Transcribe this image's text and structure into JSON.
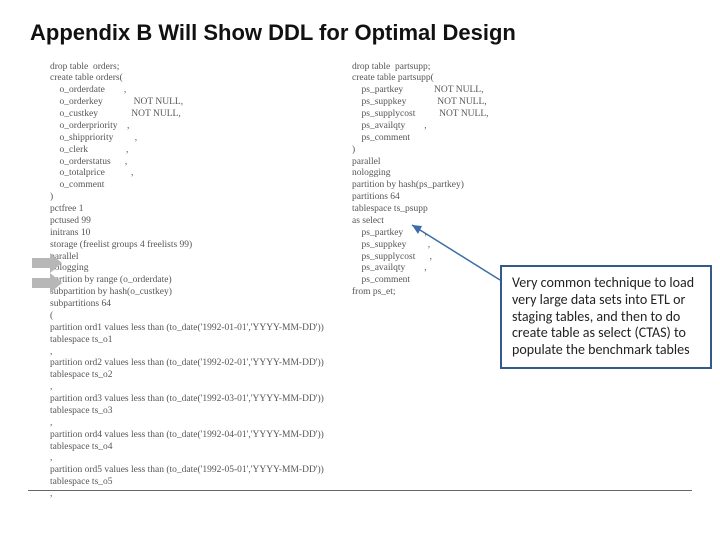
{
  "title": "Appendix B Will Show DDL for Optimal Design",
  "ddl_left": "drop table  orders;\ncreate table orders(\n    o_orderdate        ,\n    o_orderkey             NOT NULL,\n    o_custkey              NOT NULL,\n    o_orderpriority    ,\n    o_shippriority         ,\n    o_clerk                ,\n    o_orderstatus      ,\n    o_totalprice           ,\n    o_comment\n)\npctfree 1\npctused 99\ninitrans 10\nstorage (freelist groups 4 freelists 99)\nparallel\nnologging\npartition by range (o_orderdate)\nsubpartition by hash(o_custkey)\nsubpartitions 64\n(\npartition ord1 values less than (to_date('1992-01-01','YYYY-MM-DD'))\ntablespace ts_o1\n,\npartition ord2 values less than (to_date('1992-02-01','YYYY-MM-DD'))\ntablespace ts_o2\n,\npartition ord3 values less than (to_date('1992-03-01','YYYY-MM-DD'))\ntablespace ts_o3\n,\npartition ord4 values less than (to_date('1992-04-01','YYYY-MM-DD'))\ntablespace ts_o4\n,\npartition ord5 values less than (to_date('1992-05-01','YYYY-MM-DD'))\ntablespace ts_o5\n,",
  "ddl_right": "drop table  partsupp;\ncreate table partsupp(\n    ps_partkey             NOT NULL,\n    ps_suppkey             NOT NULL,\n    ps_supplycost          NOT NULL,\n    ps_availqty        ,\n    ps_comment\n)\nparallel\nnologging\npartition by hash(ps_partkey)\npartitions 64\ntablespace ts_psupp\nas select\n    ps_partkey         ,\n    ps_suppkey         ,\n    ps_supplycost      ,\n    ps_availqty        ,\n    ps_comment\nfrom ps_et;",
  "callout": "Very common technique to load very large data sets into ETL or staging tables, and then to do create table as select (CTAS) to populate the benchmark tables"
}
